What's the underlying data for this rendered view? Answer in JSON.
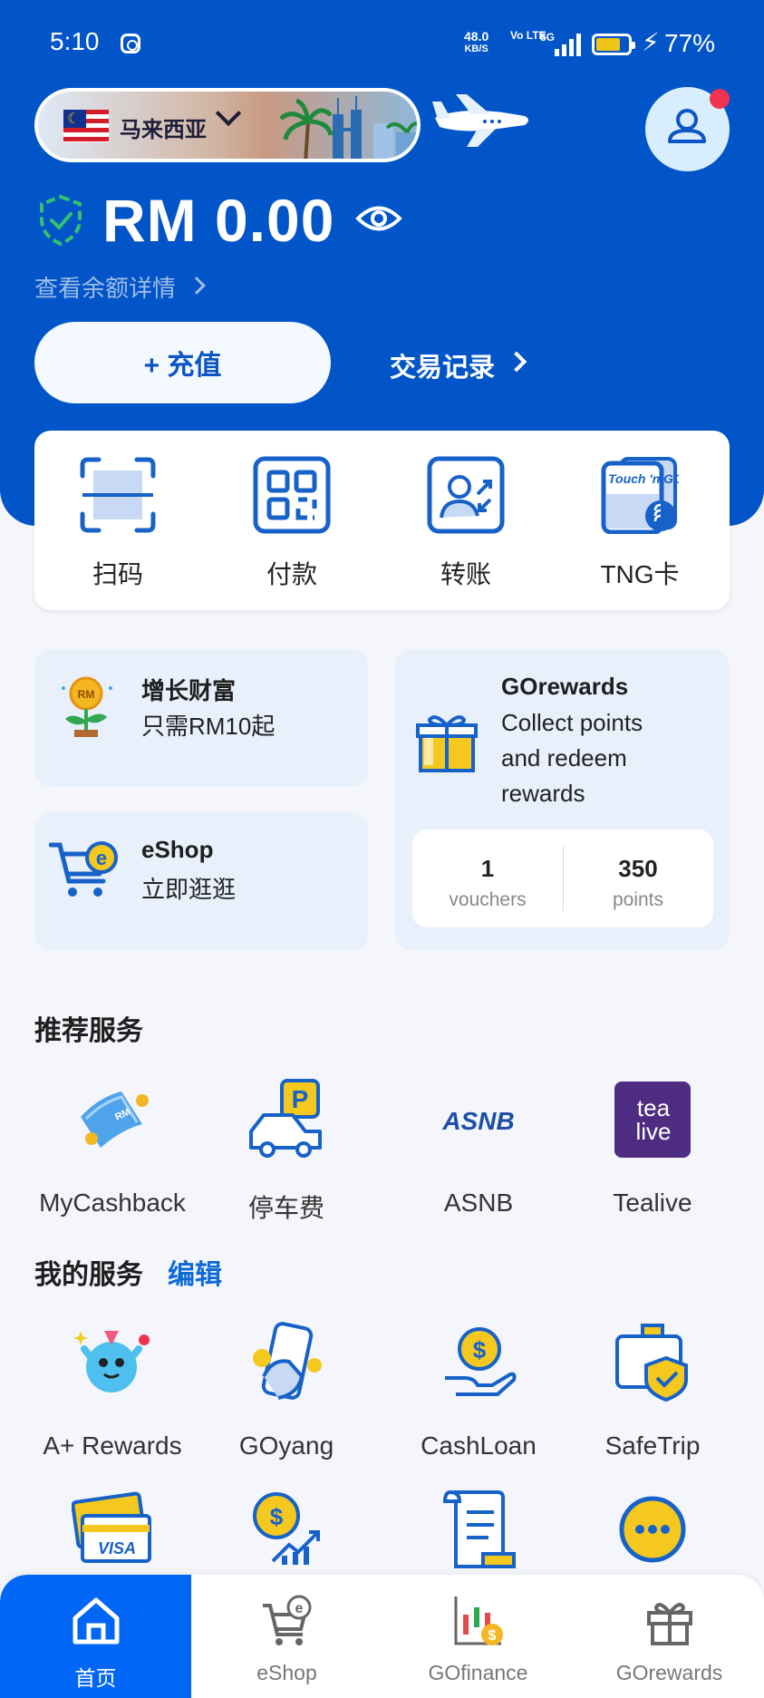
{
  "status_bar": {
    "time": "5:10",
    "net_speed": "48.0",
    "net_unit": "KB/S",
    "volte": "Vo LTE",
    "signal": "5G",
    "battery_percent": "77%",
    "battery_level": 0.77
  },
  "header": {
    "country": "马来西亚",
    "balance": "RM 0.00",
    "balance_detail": "查看余额详情",
    "topup_label": "+ 充值",
    "history_label": "交易记录"
  },
  "quick_actions": [
    {
      "label": "扫码",
      "icon": "scan-icon"
    },
    {
      "label": "付款",
      "icon": "qr-pay-icon"
    },
    {
      "label": "转账",
      "icon": "transfer-icon"
    },
    {
      "label": "TNG卡",
      "icon": "tng-card-icon",
      "card_text": "Touch 'n GO"
    }
  ],
  "promos": {
    "wealth": {
      "title": "增长财富",
      "subtitle": "只需RM10起",
      "badge": "RM"
    },
    "eshop": {
      "title": "eShop",
      "subtitle": "立即逛逛"
    },
    "gorewards": {
      "title": "GOrewards",
      "subtitle": [
        "Collect points",
        "and redeem",
        "rewards"
      ],
      "vouchers_value": "1",
      "vouchers_label": "vouchers",
      "points_value": "350",
      "points_label": "points"
    }
  },
  "recommended": {
    "title": "推荐服务",
    "items": [
      {
        "label": "MyCashback",
        "icon": "cashback-icon",
        "badge": "RM"
      },
      {
        "label": "停车费",
        "icon": "parking-icon",
        "badge": "P"
      },
      {
        "label": "ASNB",
        "icon": "asnb-icon",
        "logo_text": "ASNB"
      },
      {
        "label": "Tealive",
        "icon": "tealive-icon",
        "logo_lines": [
          "tea",
          "live"
        ]
      }
    ]
  },
  "my_services": {
    "title": "我的服务",
    "edit_label": "编辑",
    "items": [
      {
        "label": "A+ Rewards",
        "icon": "a-plus-rewards-icon"
      },
      {
        "label": "GOyang",
        "icon": "goyang-icon"
      },
      {
        "label": "CashLoan",
        "icon": "cashloan-icon"
      },
      {
        "label": "SafeTrip",
        "icon": "safetrip-icon"
      },
      {
        "label": "",
        "icon": "visa-card-icon",
        "card_text": "VISA"
      },
      {
        "label": "",
        "icon": "invest-growth-icon"
      },
      {
        "label": "",
        "icon": "document-icon"
      },
      {
        "label": "",
        "icon": "more-icon"
      }
    ]
  },
  "bottom_nav": [
    {
      "label": "首页",
      "icon": "home-icon",
      "active": true
    },
    {
      "label": "eShop",
      "icon": "eshop-cart-icon",
      "active": false
    },
    {
      "label": "GOfinance",
      "icon": "gofinance-chart-icon",
      "active": false
    },
    {
      "label": "GOrewards",
      "icon": "gift-icon",
      "active": false
    }
  ],
  "colors": {
    "primary_blue": "#0155c8",
    "nav_active": "#0066f5",
    "accent_yellow": "#f4c81e",
    "notification_red": "#f0334f"
  }
}
